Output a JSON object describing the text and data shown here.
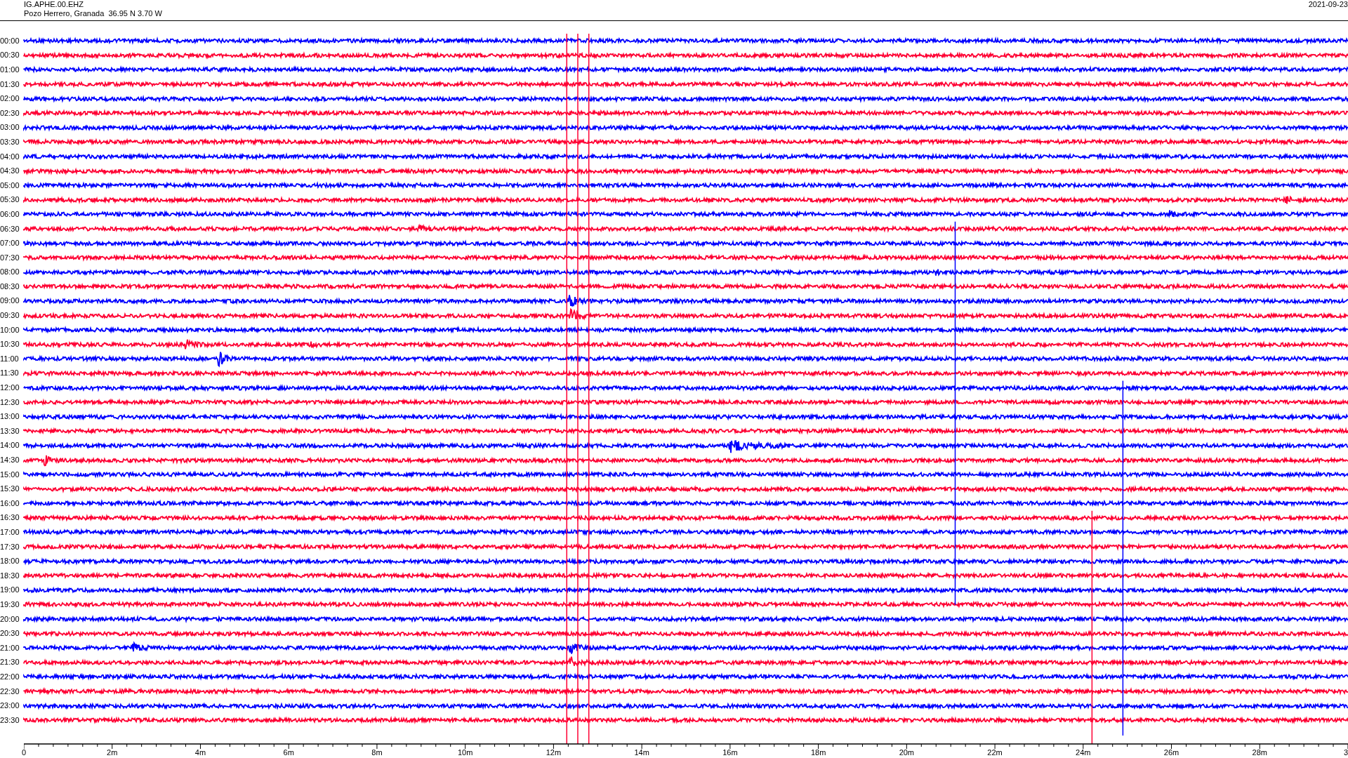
{
  "header": {
    "station": "IG.APHE.00.EHZ",
    "location": "Pozo Herrero, Granada  36.95 N 3.70 W",
    "date": "2021-09-23"
  },
  "rows": [
    {
      "time": "00:00",
      "color": "#0000ff"
    },
    {
      "time": "00:30",
      "color": "#ff0033"
    },
    {
      "time": "01:00",
      "color": "#0000ff"
    },
    {
      "time": "01:30",
      "color": "#ff0033"
    },
    {
      "time": "02:00",
      "color": "#0000ff"
    },
    {
      "time": "02:30",
      "color": "#ff0033"
    },
    {
      "time": "03:00",
      "color": "#0000ff"
    },
    {
      "time": "03:30",
      "color": "#ff0033"
    },
    {
      "time": "04:00",
      "color": "#0000ff"
    },
    {
      "time": "04:30",
      "color": "#ff0033"
    },
    {
      "time": "05:00",
      "color": "#0000ff"
    },
    {
      "time": "05:30",
      "color": "#ff0033"
    },
    {
      "time": "06:00",
      "color": "#0000ff"
    },
    {
      "time": "06:30",
      "color": "#ff0033"
    },
    {
      "time": "07:00",
      "color": "#0000ff"
    },
    {
      "time": "07:30",
      "color": "#ff0033"
    },
    {
      "time": "08:00",
      "color": "#0000ff"
    },
    {
      "time": "08:30",
      "color": "#ff0033"
    },
    {
      "time": "09:00",
      "color": "#0000ff"
    },
    {
      "time": "09:30",
      "color": "#ff0033"
    },
    {
      "time": "10:00",
      "color": "#0000ff"
    },
    {
      "time": "10:30",
      "color": "#ff0033"
    },
    {
      "time": "11:00",
      "color": "#0000ff"
    },
    {
      "time": "11:30",
      "color": "#ff0033"
    },
    {
      "time": "12:00",
      "color": "#0000ff"
    },
    {
      "time": "12:30",
      "color": "#ff0033"
    },
    {
      "time": "13:00",
      "color": "#0000ff"
    },
    {
      "time": "13:30",
      "color": "#ff0033"
    },
    {
      "time": "14:00",
      "color": "#0000ff"
    },
    {
      "time": "14:30",
      "color": "#ff0033"
    },
    {
      "time": "15:00",
      "color": "#0000ff"
    },
    {
      "time": "15:30",
      "color": "#ff0033"
    },
    {
      "time": "16:00",
      "color": "#0000ff"
    },
    {
      "time": "16:30",
      "color": "#ff0033"
    },
    {
      "time": "17:00",
      "color": "#0000ff"
    },
    {
      "time": "17:30",
      "color": "#ff0033"
    },
    {
      "time": "18:00",
      "color": "#0000ff"
    },
    {
      "time": "18:30",
      "color": "#ff0033"
    },
    {
      "time": "19:00",
      "color": "#0000ff"
    },
    {
      "time": "19:30",
      "color": "#ff0033"
    },
    {
      "time": "20:00",
      "color": "#0000ff"
    },
    {
      "time": "20:30",
      "color": "#ff0033"
    },
    {
      "time": "21:00",
      "color": "#0000ff"
    },
    {
      "time": "21:30",
      "color": "#ff0033"
    },
    {
      "time": "22:00",
      "color": "#0000ff"
    },
    {
      "time": "22:30",
      "color": "#ff0033"
    },
    {
      "time": "23:00",
      "color": "#0000ff"
    },
    {
      "time": "23:30",
      "color": "#ff0033"
    }
  ],
  "time_axis": {
    "ticks": [
      "0",
      "2m",
      "4m",
      "6m",
      "8m",
      "10m",
      "12m",
      "14m",
      "16m",
      "18m",
      "20m",
      "22m",
      "24m",
      "26m",
      "28m",
      "3"
    ]
  }
}
